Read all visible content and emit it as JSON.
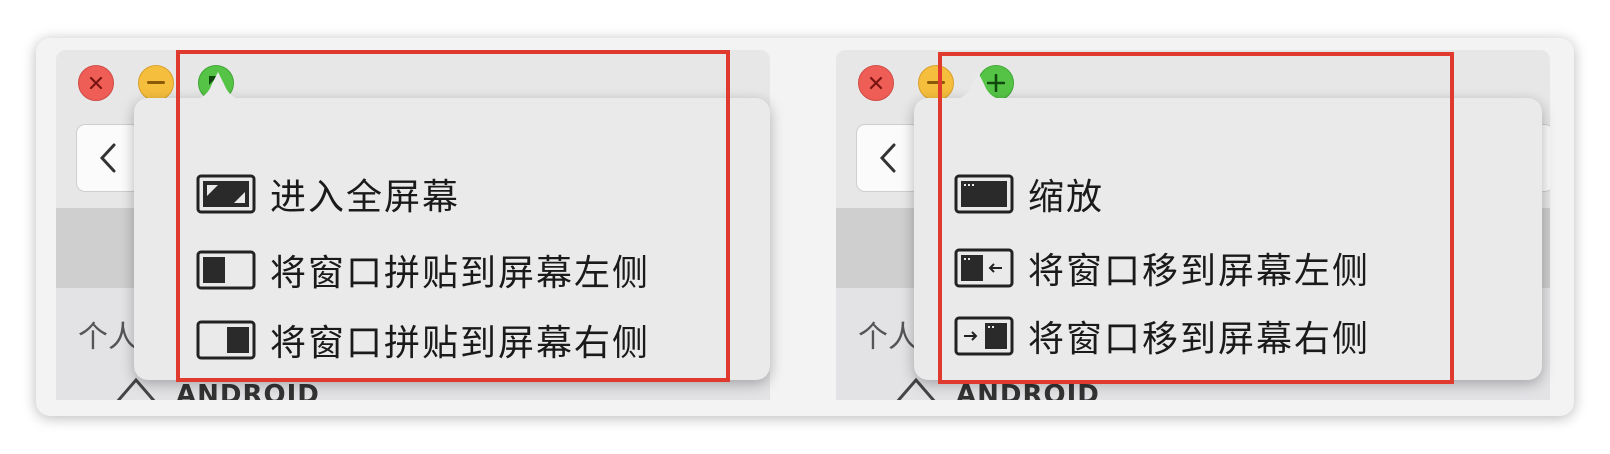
{
  "left_window": {
    "zoom_state": "fullscreen",
    "sidebar_label": "个人",
    "bottom_label": "ANDROID",
    "menu": [
      {
        "icon": "fullscreen-icon",
        "label": "进入全屏幕"
      },
      {
        "icon": "tile-left-icon",
        "label": "将窗口拼贴到屏幕左侧"
      },
      {
        "icon": "tile-right-icon",
        "label": "将窗口拼贴到屏幕右侧"
      }
    ]
  },
  "right_window": {
    "zoom_state": "zoom",
    "sidebar_label": "个人",
    "bottom_label": "ANDROID",
    "menu": [
      {
        "icon": "zoom-window-icon",
        "label": "缩放"
      },
      {
        "icon": "move-left-icon",
        "label": "将窗口移到屏幕左侧"
      },
      {
        "icon": "move-right-icon",
        "label": "将窗口移到屏幕右侧"
      }
    ]
  },
  "colors": {
    "close": "#ee5d56",
    "minimize": "#f5be3d",
    "zoom": "#55c446",
    "highlight_border": "#e03a2f"
  }
}
